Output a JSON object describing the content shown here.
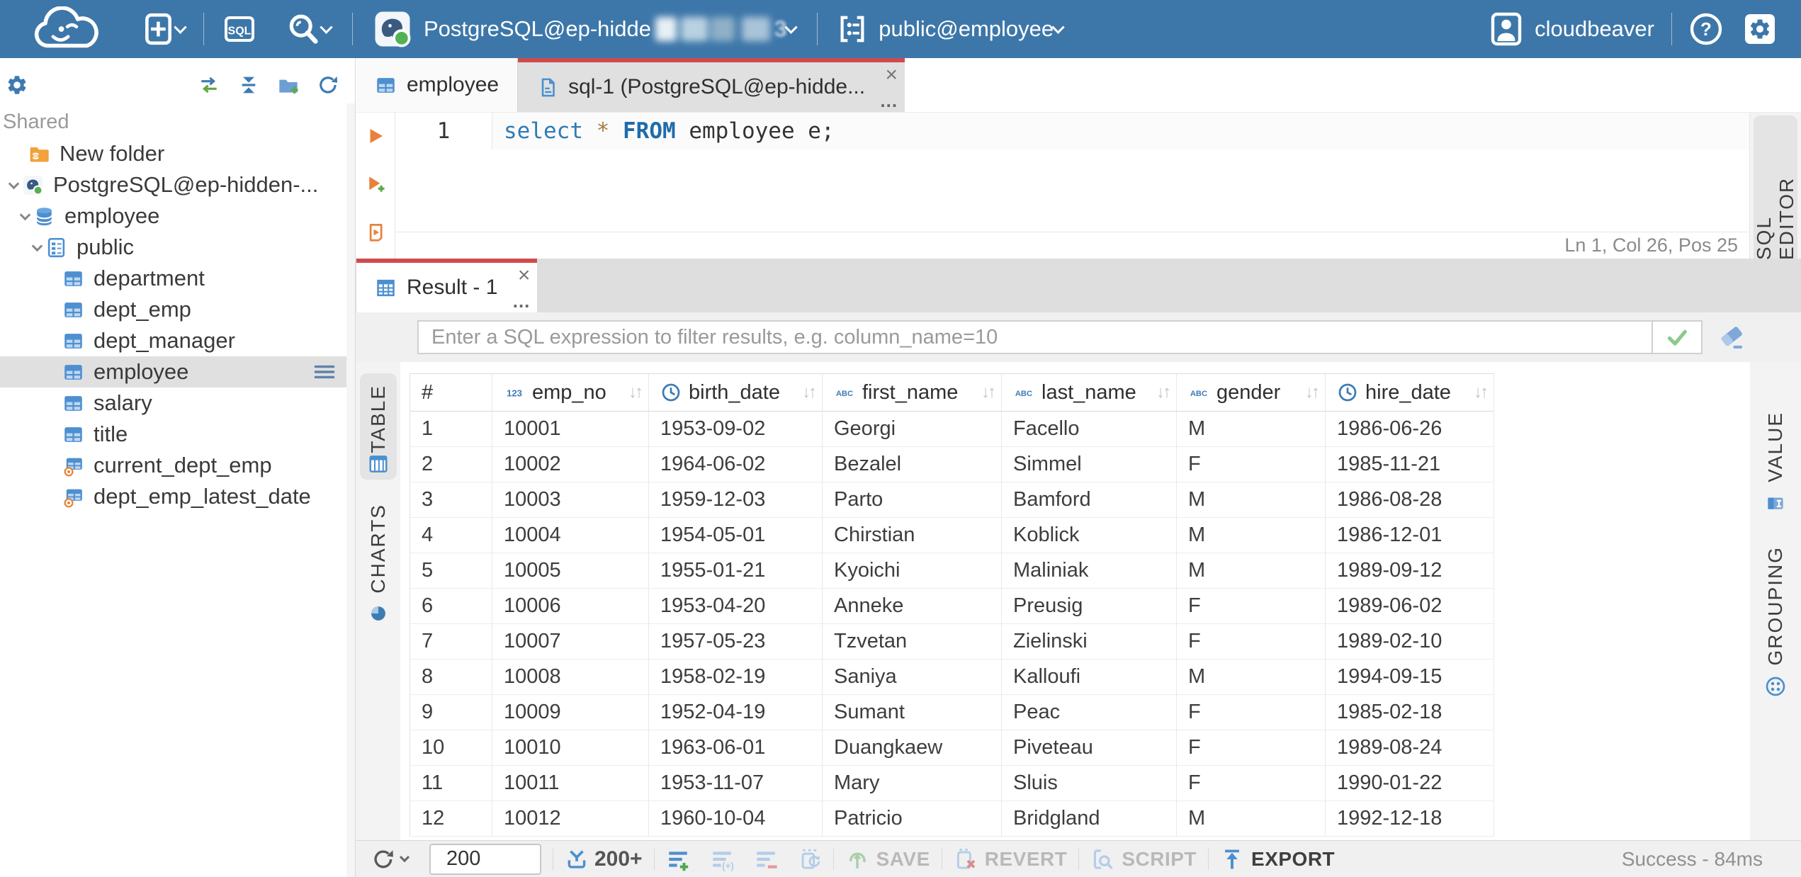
{
  "topbar": {
    "sql_button": "SQL",
    "connection": {
      "label": "PostgreSQL@ep-hidde",
      "visible_suffix": "3"
    },
    "schema_selector": {
      "label": "public@employee"
    },
    "user": {
      "name": "cloudbeaver"
    }
  },
  "sidebar": {
    "section_label": "Shared",
    "tree": [
      {
        "label": "New folder",
        "icon": "folderdb",
        "pad": 40,
        "chevron": false,
        "selected": false,
        "menu": false
      },
      {
        "label": "PostgreSQL@ep-hidden-...",
        "icon": "postgres",
        "pad": 8,
        "chevron": true,
        "selected": false,
        "menu": false
      },
      {
        "label": "employee",
        "icon": "database",
        "pad": 24,
        "chevron": true,
        "selected": false,
        "menu": false
      },
      {
        "label": "public",
        "icon": "schema",
        "pad": 41,
        "chevron": true,
        "selected": false,
        "menu": false
      },
      {
        "label": "department",
        "icon": "table",
        "pad": 88,
        "chevron": false,
        "selected": false,
        "menu": false
      },
      {
        "label": "dept_emp",
        "icon": "table",
        "pad": 88,
        "chevron": false,
        "selected": false,
        "menu": false
      },
      {
        "label": "dept_manager",
        "icon": "table",
        "pad": 88,
        "chevron": false,
        "selected": false,
        "menu": false
      },
      {
        "label": "employee",
        "icon": "table",
        "pad": 88,
        "chevron": false,
        "selected": true,
        "menu": true
      },
      {
        "label": "salary",
        "icon": "table",
        "pad": 88,
        "chevron": false,
        "selected": false,
        "menu": false
      },
      {
        "label": "title",
        "icon": "table",
        "pad": 88,
        "chevron": false,
        "selected": false,
        "menu": false
      },
      {
        "label": "current_dept_emp",
        "icon": "view",
        "pad": 88,
        "chevron": false,
        "selected": false,
        "menu": false
      },
      {
        "label": "dept_emp_latest_date",
        "icon": "view",
        "pad": 88,
        "chevron": false,
        "selected": false,
        "menu": false
      }
    ]
  },
  "editor": {
    "tabs": {
      "table_tab": {
        "label": "employee"
      },
      "sql_tab": {
        "label": "sql-1 (PostgreSQL@ep-hidde..."
      }
    },
    "line_number": "1",
    "code_tokens": [
      {
        "text": "select",
        "cls": "kw"
      },
      {
        "text": " ",
        "cls": "plain"
      },
      {
        "text": "*",
        "cls": "star"
      },
      {
        "text": " ",
        "cls": "plain"
      },
      {
        "text": "FROM",
        "cls": "kwb"
      },
      {
        "text": " employee e;",
        "cls": "plain"
      }
    ],
    "status": "Ln 1, Col 26, Pos 25",
    "side_tab": "SQL EDITOR"
  },
  "result": {
    "tab_label": "Result - 1",
    "filter_placeholder": "Enter a SQL expression to filter results, e.g. column_name=10",
    "table_tab": "TABLE",
    "charts_tab": "CHARTS",
    "value_tab": "VALUE",
    "grouping_tab": "GROUPING",
    "grid": {
      "columns": [
        {
          "name": "#",
          "type": ""
        },
        {
          "name": "emp_no",
          "type": "number"
        },
        {
          "name": "birth_date",
          "type": "date"
        },
        {
          "name": "first_name",
          "type": "text"
        },
        {
          "name": "last_name",
          "type": "text"
        },
        {
          "name": "gender",
          "type": "text"
        },
        {
          "name": "hire_date",
          "type": "date"
        }
      ],
      "rows": [
        [
          "1",
          "10001",
          "1953-09-02",
          "Georgi",
          "Facello",
          "M",
          "1986-06-26"
        ],
        [
          "2",
          "10002",
          "1964-06-02",
          "Bezalel",
          "Simmel",
          "F",
          "1985-11-21"
        ],
        [
          "3",
          "10003",
          "1959-12-03",
          "Parto",
          "Bamford",
          "M",
          "1986-08-28"
        ],
        [
          "4",
          "10004",
          "1954-05-01",
          "Chirstian",
          "Koblick",
          "M",
          "1986-12-01"
        ],
        [
          "5",
          "10005",
          "1955-01-21",
          "Kyoichi",
          "Maliniak",
          "M",
          "1989-09-12"
        ],
        [
          "6",
          "10006",
          "1953-04-20",
          "Anneke",
          "Preusig",
          "F",
          "1989-06-02"
        ],
        [
          "7",
          "10007",
          "1957-05-23",
          "Tzvetan",
          "Zielinski",
          "F",
          "1989-02-10"
        ],
        [
          "8",
          "10008",
          "1958-02-19",
          "Saniya",
          "Kalloufi",
          "M",
          "1994-09-15"
        ],
        [
          "9",
          "10009",
          "1952-04-19",
          "Sumant",
          "Peac",
          "F",
          "1985-02-18"
        ],
        [
          "10",
          "10010",
          "1963-06-01",
          "Duangkaew",
          "Piveteau",
          "F",
          "1989-08-24"
        ],
        [
          "11",
          "10011",
          "1953-11-07",
          "Mary",
          "Sluis",
          "F",
          "1990-01-22"
        ],
        [
          "12",
          "10012",
          "1960-10-04",
          "Patricio",
          "Bridgland",
          "M",
          "1992-12-18"
        ]
      ]
    },
    "toolbar": {
      "fetch_size": "200",
      "fetch_more": "200+",
      "save": "SAVE",
      "revert": "REVERT",
      "script": "SCRIPT",
      "export": "EXPORT",
      "status": "Success - 84ms"
    }
  }
}
